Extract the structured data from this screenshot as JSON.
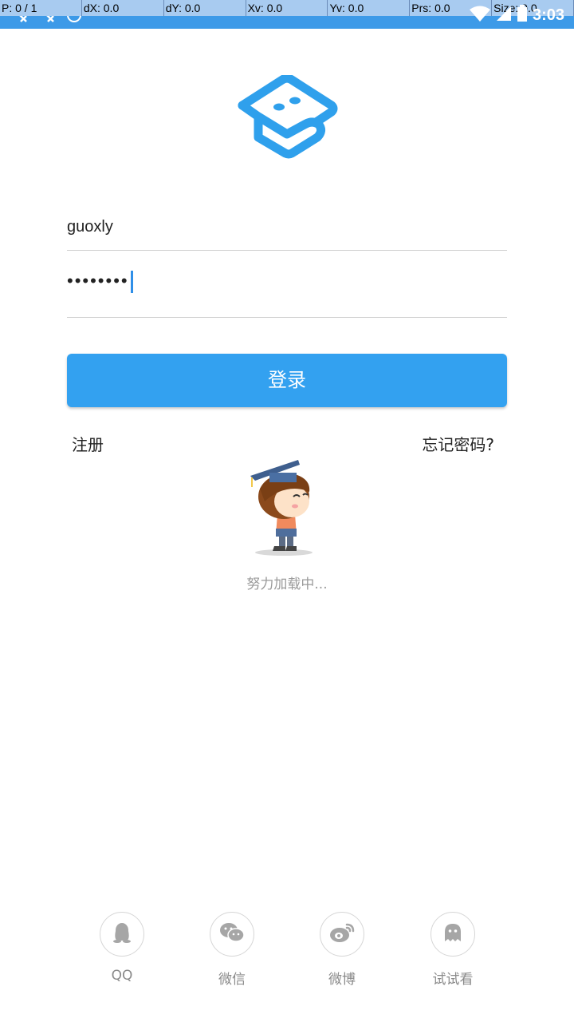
{
  "status_bar": {
    "pointer_info": [
      "P: 0 / 1",
      "dX: 0.0",
      "dY: 0.0",
      "Xv: 0.0",
      "Yv: 0.0",
      "Prs: 0.0",
      "Size: 0.0"
    ],
    "time": "3:03"
  },
  "login": {
    "username": "guoxly",
    "password_mask": "••••••••",
    "button_label": "登录",
    "register_label": "注册",
    "forgot_label": "忘记密码?"
  },
  "loading": {
    "text": "努力加载中..."
  },
  "social": [
    {
      "label": "QQ",
      "icon": "qq-icon"
    },
    {
      "label": "微信",
      "icon": "wechat-icon"
    },
    {
      "label": "微博",
      "icon": "weibo-icon"
    },
    {
      "label": "试试看",
      "icon": "ghost-icon"
    }
  ],
  "colors": {
    "accent": "#33a1f0",
    "status_bar": "#3d9ae8",
    "icon_gray": "#a6a6a6"
  }
}
